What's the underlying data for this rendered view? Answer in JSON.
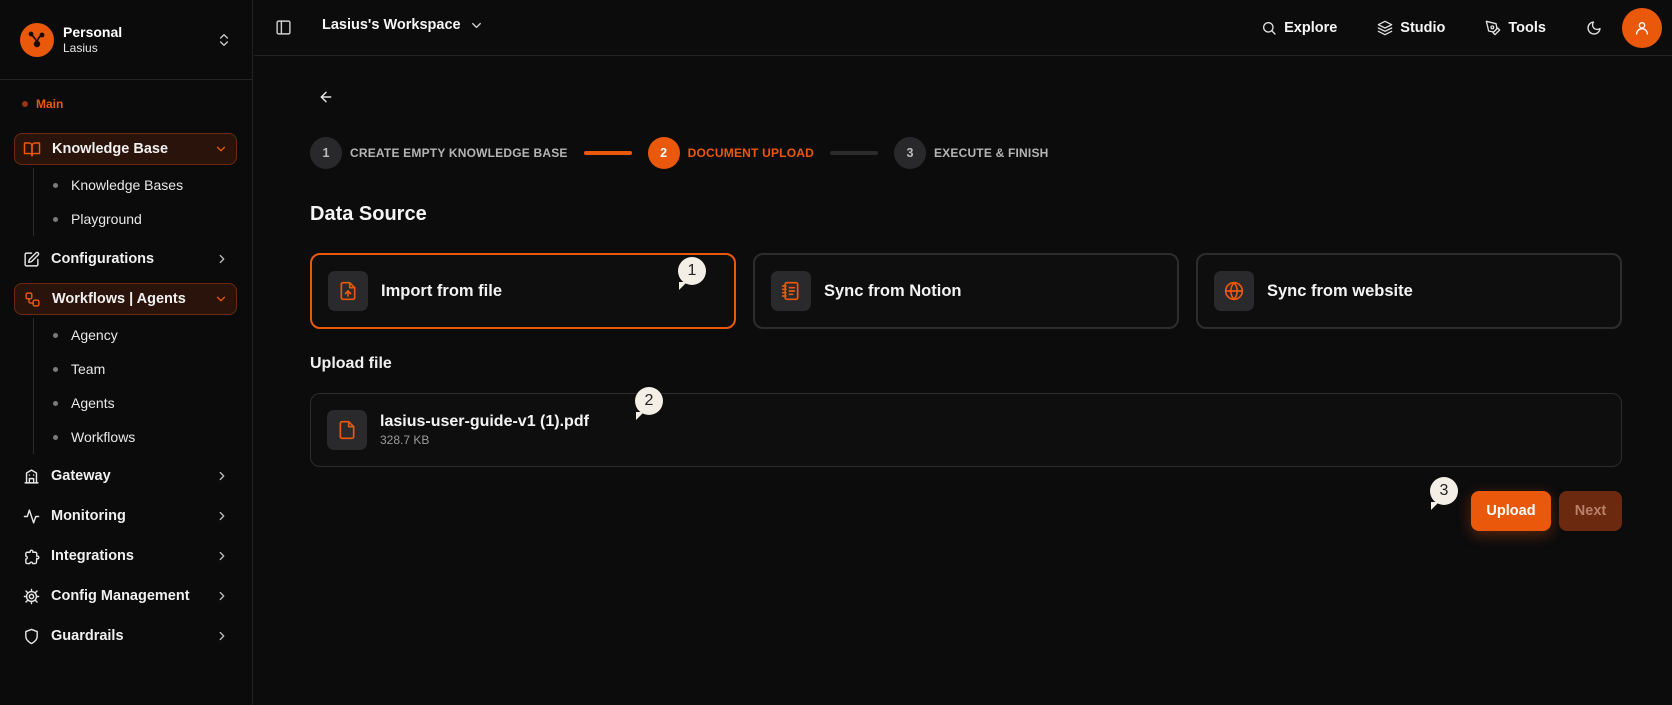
{
  "account": {
    "name": "Personal",
    "user": "Lasius"
  },
  "sidebar": {
    "section": "Main",
    "knowledge_base": {
      "label": "Knowledge Base",
      "children": [
        "Knowledge Bases",
        "Playground"
      ]
    },
    "configurations": "Configurations",
    "workflows": {
      "label": "Workflows | Agents",
      "children": [
        "Agency",
        "Team",
        "Agents",
        "Workflows"
      ]
    },
    "gateway": "Gateway",
    "monitoring": "Monitoring",
    "integrations": "Integrations",
    "config_management": "Config Management",
    "guardrails": "Guardrails"
  },
  "header": {
    "workspace": "Lasius's Workspace",
    "nav": {
      "explore": "Explore",
      "studio": "Studio",
      "tools": "Tools"
    }
  },
  "stepper": {
    "steps": [
      {
        "num": "1",
        "label": "CREATE EMPTY KNOWLEDGE BASE"
      },
      {
        "num": "2",
        "label": "DOCUMENT UPLOAD"
      },
      {
        "num": "3",
        "label": "EXECUTE & FINISH"
      }
    ],
    "current": 2
  },
  "main": {
    "title": "Data Source",
    "sources": [
      "Import from file",
      "Sync from Notion",
      "Sync from website"
    ],
    "upload_title": "Upload file",
    "file": {
      "name": "lasius-user-guide-v1 (1).pdf",
      "size": "328.7 KB"
    },
    "upload_label": "Upload",
    "next_label": "Next"
  },
  "callouts": [
    "1",
    "2",
    "3"
  ],
  "colors": {
    "accent": "#ea580c",
    "background": "#0c0c0d"
  }
}
